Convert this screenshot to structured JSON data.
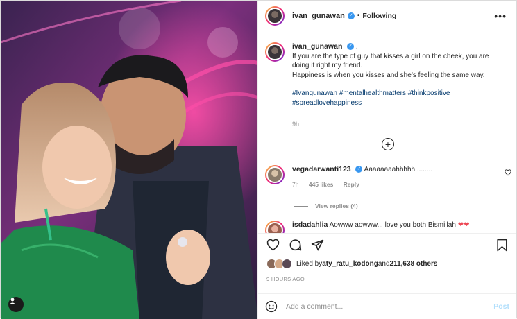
{
  "post": {
    "author": "ivan_gunawan",
    "follow_status": "Following",
    "more_label": "•••",
    "caption_suffix": ".",
    "caption_line1": "If you are the type of guy that kisses a girl on the cheek, you are doing it right my friend.",
    "caption_line2": "Happiness is when you kisses and she’s feeling the same way.",
    "hashtags": [
      "#Ivangunawan",
      "#mentalhealthmatters",
      "#thinkpositive",
      "#spreadlovehappiness"
    ],
    "caption_time": "9h",
    "load_more": "+"
  },
  "comments": [
    {
      "user": "vegadarwanti123",
      "text": "Aaaaaaaahhhhh.........",
      "time": "7h",
      "likes": "445 likes",
      "reply": "Reply",
      "view_replies": "View replies (4)"
    },
    {
      "user": "isdadahlia",
      "text": "Aowww aowww... love you both Bismillah"
    }
  ],
  "likes": {
    "prefix": "Liked by ",
    "user": "aty_ratu_kodong",
    "middle": " and ",
    "others": "211,638 others"
  },
  "posted_ago": "9 HOURS AGO",
  "add_comment": {
    "placeholder": "Add a comment...",
    "post_label": "Post"
  },
  "icons": {
    "photo_tag": "user-tag-icon",
    "like": "heart-icon",
    "comment": "comment-icon",
    "share": "send-icon",
    "save": "bookmark-icon",
    "emoji": "emoji-icon"
  },
  "colors": {
    "accent": "#3897f0",
    "hashtag": "#00376b",
    "muted": "#8e8e8e",
    "post_disabled": "#b2dffc",
    "heart": "#ed4956"
  }
}
